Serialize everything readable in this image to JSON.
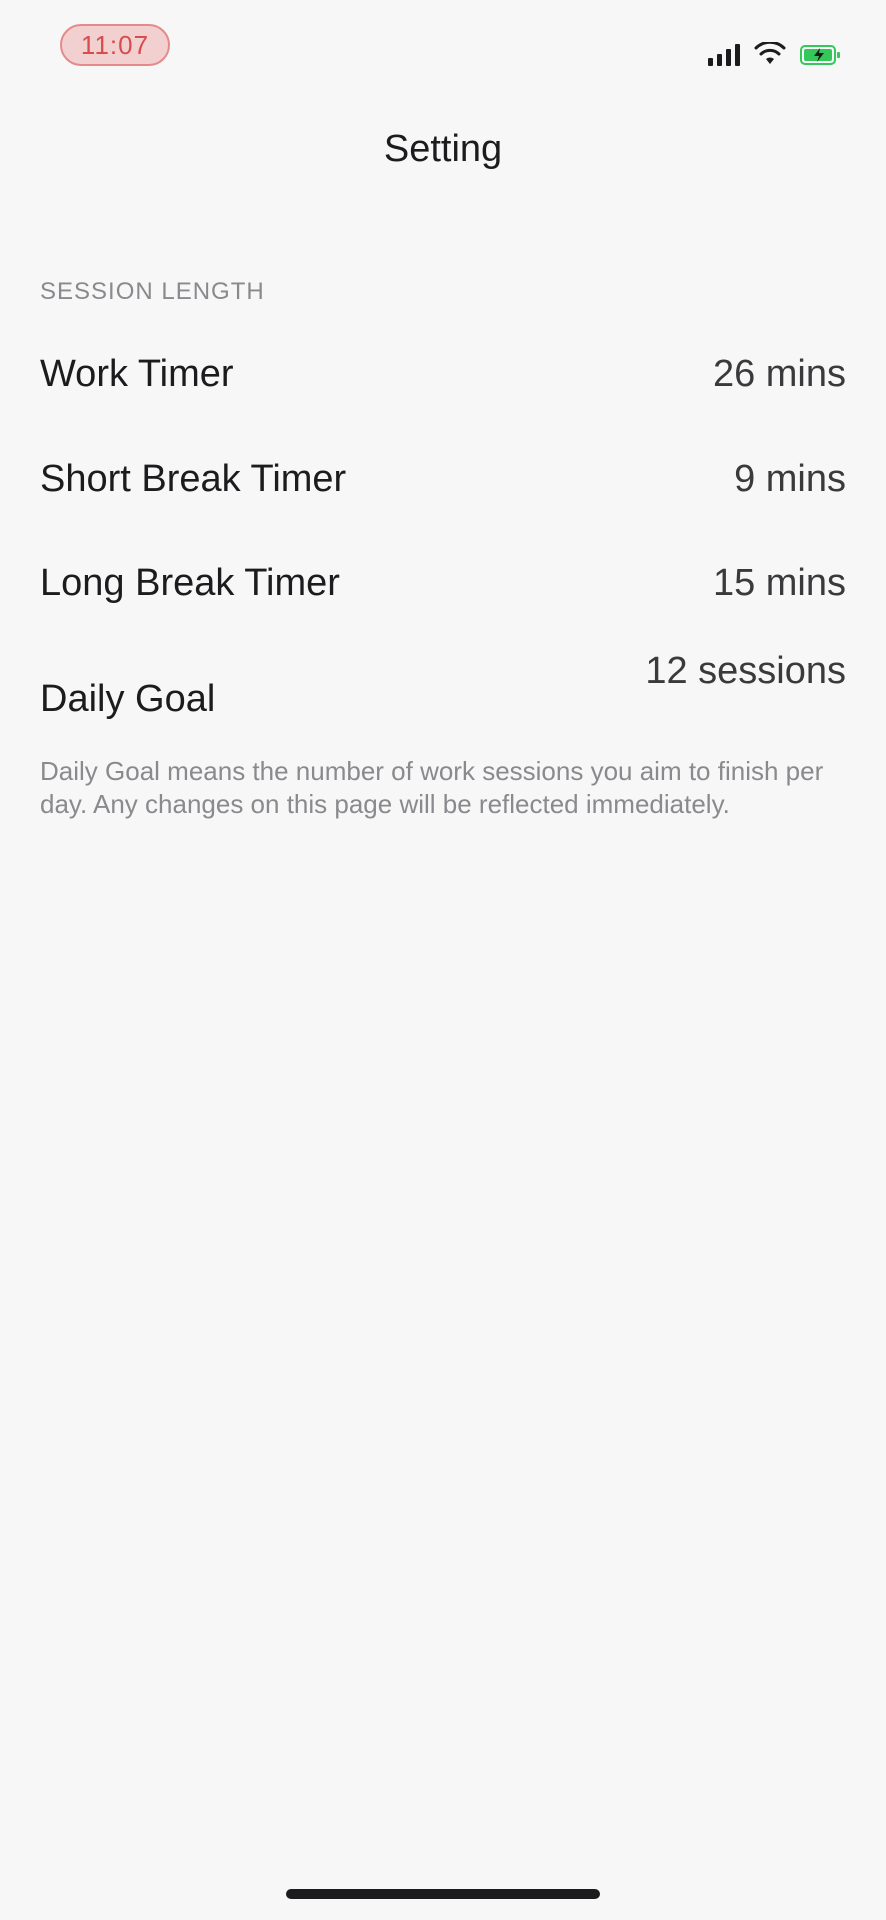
{
  "status_bar": {
    "time": "11:07",
    "icons": [
      "cellular-signal-icon",
      "wifi-icon",
      "battery-charging-icon"
    ],
    "time_pill_color": "#d94c4c",
    "battery_color": "#34c759"
  },
  "nav": {
    "title": "Setting"
  },
  "section": {
    "header": "SESSION LENGTH",
    "rows": [
      {
        "label": "Work Timer",
        "value": "26 mins"
      },
      {
        "label": "Short Break Timer",
        "value": "9 mins"
      },
      {
        "label": "Long Break Timer",
        "value": "15 mins"
      },
      {
        "label": "Daily Goal",
        "value": "12 sessions"
      }
    ],
    "footer": "Daily Goal means the number of work sessions you aim to finish per day. Any changes on this page will be reflected immediately."
  }
}
